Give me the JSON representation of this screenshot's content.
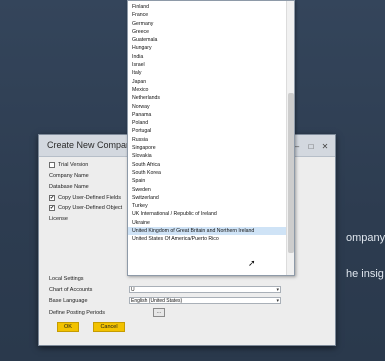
{
  "background": {
    "text_1": "ompany",
    "text_2": "he insig"
  },
  "dialog": {
    "title": "Create New Compan",
    "window_buttons": [
      "–",
      "□",
      "✕"
    ],
    "fields": {
      "trial_version": "Trial Version",
      "company_name": "Company Name",
      "database_name": "Database Name",
      "copy_udf": "Copy User-Defined Fields",
      "copy_udo": "Copy User-Defined Object",
      "license": "License",
      "local_settings": "Local Settings",
      "chart_of_accounts": "Chart of Accounts",
      "base_language": "Base Language",
      "define_posting_periods": "Define Posting Periods"
    },
    "values": {
      "chart_of_accounts": "U",
      "base_language": "English (United States)",
      "posting_periods_button": "..."
    },
    "buttons": {
      "ok": "OK",
      "cancel": "Cancel"
    }
  },
  "dropdown": {
    "items": [
      "Finland",
      "France",
      "Germany",
      "Greece",
      "Guatemala",
      "Hungary",
      "India",
      "Israel",
      "Italy",
      "Japan",
      "Mexico",
      "Netherlands",
      "Norway",
      "Panama",
      "Poland",
      "Portugal",
      "Russia",
      "Singapore",
      "Slovakia",
      "South Africa",
      "South Korea",
      "Spain",
      "Sweden",
      "Switzerland",
      "Turkey",
      "UK International / Republic of Ireland",
      "Ukraine",
      "United Kingdom of Great Britain and Northern Ireland",
      "United States Of America/Puerto Rico"
    ],
    "highlighted_index": 27
  },
  "colors": {
    "accent": "#f2c200",
    "highlight": "#cfe3f6",
    "background": "#2f3e52"
  }
}
